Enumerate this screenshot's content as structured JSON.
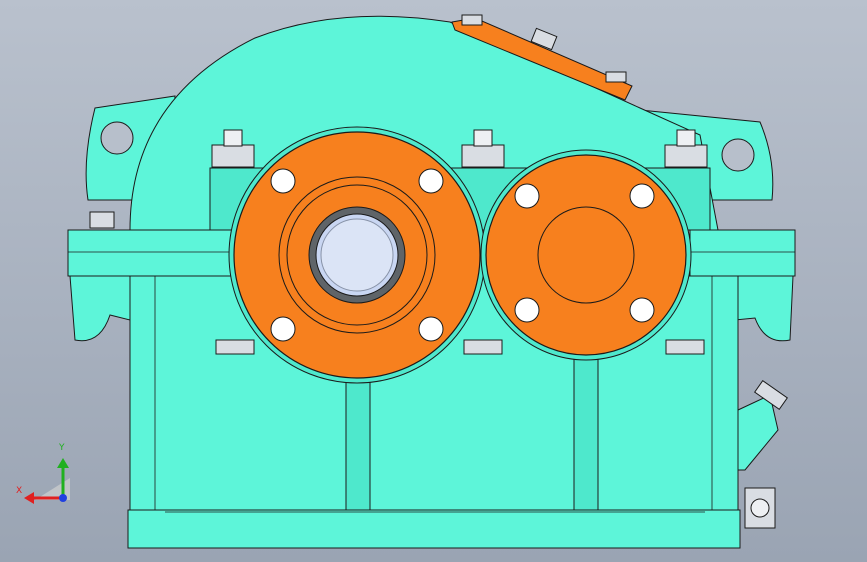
{
  "viewport": {
    "model": "gear-reducer-housing",
    "view": "front",
    "colors": {
      "background_top": "#b9c1cd",
      "background_bottom": "#9aa4b3",
      "housing": "#5df5d9",
      "housing_shadow": "#3fd9bd",
      "flange": "#f7801e",
      "flange_edge": "#b4540a",
      "bore": "#c9d6f2",
      "bolt": "#d9dde3",
      "outline": "#1a1a1a"
    }
  },
  "triad": {
    "x_label": "X",
    "y_label": "Y",
    "x_color": "#e02020",
    "y_color": "#20b020",
    "z_color": "#2040e0"
  }
}
